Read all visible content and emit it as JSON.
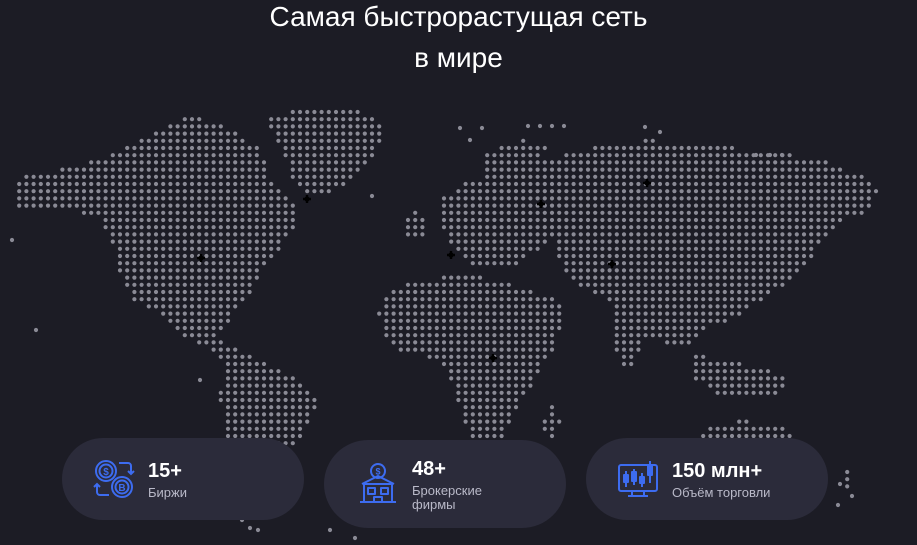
{
  "hero": {
    "title_line1": "Самая быстрорастущая сеть",
    "title_line2": "в мире"
  },
  "stats": [
    {
      "value": "15+",
      "label": "Биржи",
      "icon": "exchange-coins-icon"
    },
    {
      "value": "48+",
      "label": "Брокерские фирмы",
      "icon": "brokerage-building-icon"
    },
    {
      "value": "150 млн+",
      "label": "Объём торговли",
      "icon": "trading-chart-icon"
    }
  ],
  "colors": {
    "background": "#1c1c25",
    "card": "#2b2b3a",
    "dot": "#8a8a95",
    "marker": "#000000",
    "icon_accent": "#3d6cf0"
  }
}
